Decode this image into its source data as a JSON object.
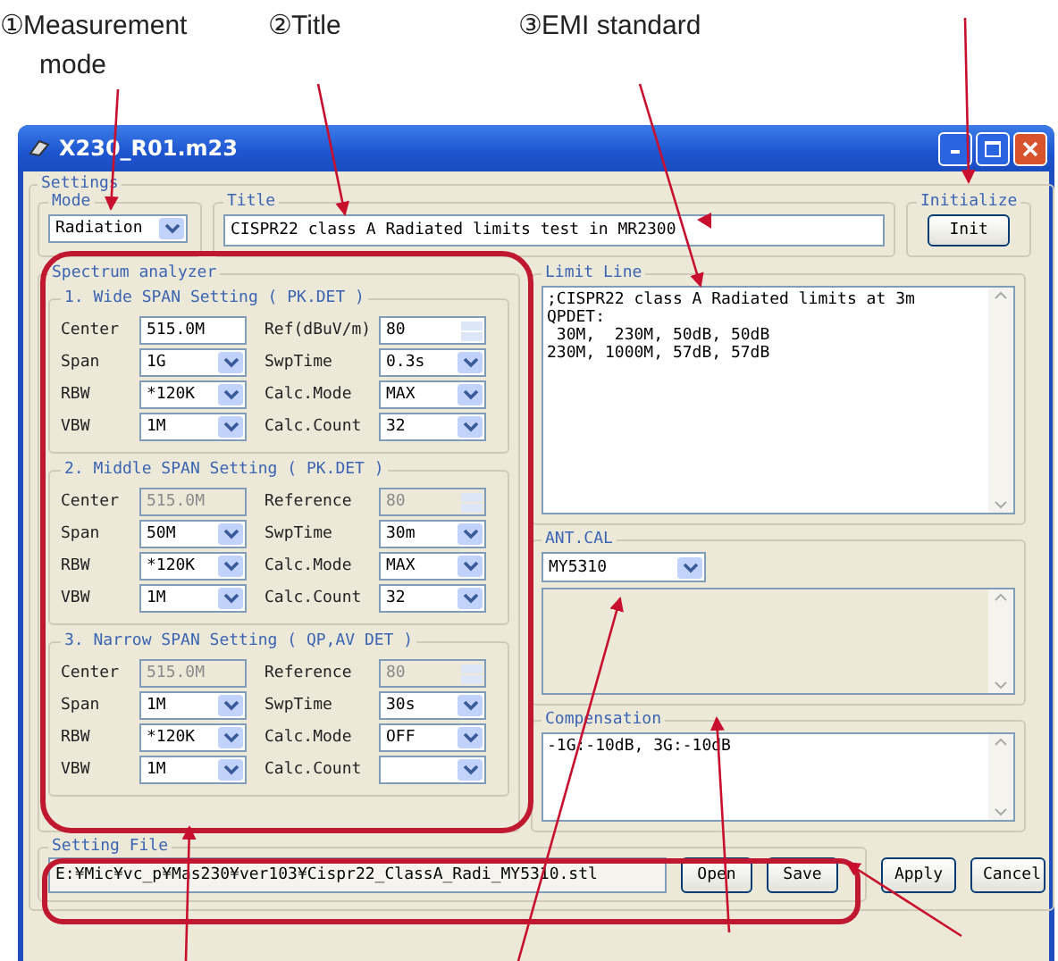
{
  "annotations": [
    {
      "number": "①",
      "text": "Measurement",
      "text2": "mode"
    },
    {
      "number": "②",
      "text": "Title"
    },
    {
      "number": "③",
      "text": "EMI standard"
    }
  ],
  "window": {
    "title": "X230_R01.m23"
  },
  "settings": {
    "label": "Settings",
    "mode": {
      "label": "Mode",
      "value": "Radiation"
    },
    "title": {
      "label": "Title",
      "value": "CISPR22 class A Radiated limits test in MR2300"
    },
    "initialize": {
      "label": "Initialize",
      "button": "Init"
    },
    "spectrum": {
      "label": "Spectrum analyzer",
      "sections": [
        {
          "title": "1. Wide SPAN Setting ( PK.DET )",
          "rows": [
            {
              "left": {
                "label": "Center",
                "value": "515.0M",
                "kind": "text",
                "disabled": false
              },
              "right": {
                "label": "Ref(dBuV/m)",
                "value": "80",
                "kind": "spin",
                "disabled": false
              }
            },
            {
              "left": {
                "label": "Span",
                "value": "1G",
                "kind": "select",
                "disabled": false
              },
              "right": {
                "label": "SwpTime",
                "value": "0.3s",
                "kind": "select",
                "disabled": false
              }
            },
            {
              "left": {
                "label": "RBW",
                "value": "*120K",
                "kind": "select",
                "disabled": false
              },
              "right": {
                "label": "Calc.Mode",
                "value": "MAX",
                "kind": "select",
                "disabled": false
              }
            },
            {
              "left": {
                "label": "VBW",
                "value": "1M",
                "kind": "select",
                "disabled": false
              },
              "right": {
                "label": "Calc.Count",
                "value": "32",
                "kind": "select",
                "disabled": false
              }
            }
          ]
        },
        {
          "title": "2. Middle SPAN Setting ( PK.DET )",
          "rows": [
            {
              "left": {
                "label": "Center",
                "value": "515.0M",
                "kind": "text",
                "disabled": true
              },
              "right": {
                "label": "Reference",
                "value": "80",
                "kind": "spin",
                "disabled": true
              }
            },
            {
              "left": {
                "label": "Span",
                "value": "50M",
                "kind": "select",
                "disabled": false
              },
              "right": {
                "label": "SwpTime",
                "value": "30m",
                "kind": "select",
                "disabled": false
              }
            },
            {
              "left": {
                "label": "RBW",
                "value": "*120K",
                "kind": "select",
                "disabled": false
              },
              "right": {
                "label": "Calc.Mode",
                "value": "MAX",
                "kind": "select",
                "disabled": false
              }
            },
            {
              "left": {
                "label": "VBW",
                "value": "1M",
                "kind": "select",
                "disabled": false
              },
              "right": {
                "label": "Calc.Count",
                "value": "32",
                "kind": "select",
                "disabled": false
              }
            }
          ]
        },
        {
          "title": "3. Narrow SPAN Setting ( QP,AV DET )",
          "rows": [
            {
              "left": {
                "label": "Center",
                "value": "515.0M",
                "kind": "text",
                "disabled": true
              },
              "right": {
                "label": "Reference",
                "value": "80",
                "kind": "spin",
                "disabled": true
              }
            },
            {
              "left": {
                "label": "Span",
                "value": "1M",
                "kind": "select",
                "disabled": false
              },
              "right": {
                "label": "SwpTime",
                "value": "30s",
                "kind": "select",
                "disabled": false
              }
            },
            {
              "left": {
                "label": "RBW",
                "value": "*120K",
                "kind": "select",
                "disabled": false
              },
              "right": {
                "label": "Calc.Mode",
                "value": "OFF",
                "kind": "select",
                "disabled": false
              }
            },
            {
              "left": {
                "label": "VBW",
                "value": "1M",
                "kind": "select",
                "disabled": false
              },
              "right": {
                "label": "Calc.Count",
                "kind": "select",
                "disabled": false
              }
            }
          ]
        }
      ]
    },
    "limit_line": {
      "label": "Limit Line",
      "lines": [
        ";CISPR22 class A Radiated limits at 3m",
        "QPDET:",
        " 30M,  230M, 50dB, 50dB",
        "230M, 1000M, 57dB, 57dB"
      ]
    },
    "ant_cal": {
      "label": "ANT.CAL",
      "value": "MY5310"
    },
    "compensation": {
      "label": "Compensation",
      "lines": [
        "-1G:-10dB, 3G:-10dB"
      ]
    },
    "setting_file": {
      "label": "Setting File",
      "path": "E:¥Mic¥vc_p¥Mas230¥ver103¥Cispr22_ClassA_Radi_MY5310.stl",
      "buttons": [
        "Open",
        "Save"
      ]
    },
    "buttons": [
      "Apply",
      "Cancel"
    ]
  }
}
